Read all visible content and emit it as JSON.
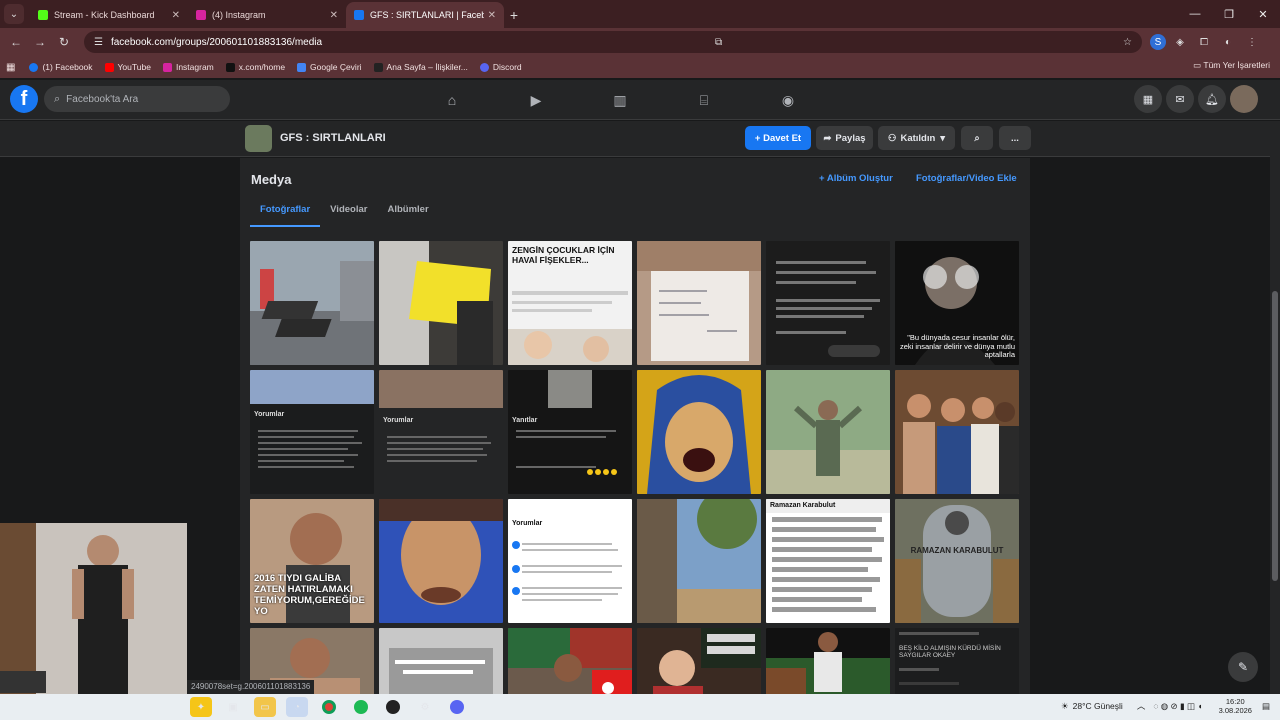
{
  "browser": {
    "tabs": [
      {
        "title": "Stream - Kick Dashboard",
        "color": "#53fc18",
        "active": false
      },
      {
        "title": "(4) Instagram",
        "color": "#d6249f",
        "active": false
      },
      {
        "title": "GFS : SIRTLANLARI | Facebook",
        "color": "#1877f2",
        "active": true
      }
    ],
    "url_host": "facebook.com",
    "url_path": "/groups/200601101883136/media",
    "bookmarks": [
      {
        "label": "(1) Facebook",
        "color": "#1877f2"
      },
      {
        "label": "YouTube",
        "color": "#ff0000"
      },
      {
        "label": "Instagram",
        "color": "#d6249f"
      },
      {
        "label": "x.com/home",
        "color": "#111111"
      },
      {
        "label": "Google Çeviri",
        "color": "#4285f4"
      },
      {
        "label": "Ana Sayfa – İlişkiler...",
        "color": "#222222"
      },
      {
        "label": "Discord",
        "color": "#5865f2"
      }
    ],
    "bookmarks_right": "Tüm Yer İşaretleri"
  },
  "fb": {
    "search_placeholder": "Facebook'ta Ara"
  },
  "group": {
    "name": "GFS : SIRTLANLARI",
    "invite": "+ Davet Et",
    "share": "Paylaş",
    "joined": "Katıldın",
    "more": "..."
  },
  "media": {
    "title": "Medya",
    "create_album": "+ Albüm Oluştur",
    "add_media": "Fotoğraflar/Video Ekle",
    "tabs": [
      "Fotoğraflar",
      "Videolar",
      "Albümler"
    ]
  },
  "photos": [
    {
      "caption": "",
      "bg": "#8d9aa6"
    },
    {
      "caption": "",
      "bg": "#3d3b38"
    },
    {
      "caption": "ZENGİN ÇOCUKLAR İÇİN HAVAİ FİŞEKLER...",
      "bg": "#f2f2f2"
    },
    {
      "caption": "",
      "bg": "#b59a86"
    },
    {
      "caption": "",
      "bg": "#1c1c1c"
    },
    {
      "caption": "\"Bu dünyada cesur insanlar ölür, zeki insanlar delirir ve dünya mutlu aptallarla",
      "bg": "#101010"
    },
    {
      "caption": "Yorumlar",
      "bg": "#1b1c1d"
    },
    {
      "caption": "Yorumlar",
      "bg": "#1f2021"
    },
    {
      "caption": "Yanıtlar",
      "bg": "#151515"
    },
    {
      "caption": "",
      "bg": "#d4a418"
    },
    {
      "caption": "",
      "bg": "#7f9a74"
    },
    {
      "caption": "",
      "bg": "#6d4b32"
    },
    {
      "caption": "2016 TIYDI GALİBA ZATEN HATIRLAMAKI TEMİYORUM,GEREĞİDE YO",
      "bg": "#b89a80"
    },
    {
      "caption": "",
      "bg": "#2f52b8"
    },
    {
      "caption": "Yorumlar",
      "bg": "#ffffff"
    },
    {
      "caption": "",
      "bg": "#7ca0c8"
    },
    {
      "caption": "Ramazan Karabulut",
      "bg": "#ffffff"
    },
    {
      "caption": "RAMAZAN KARABULUT",
      "bg": "#6e7060"
    },
    {
      "caption": "",
      "bg": "#8a7866"
    },
    {
      "caption": "",
      "bg": "#c8c8c8"
    },
    {
      "caption": "",
      "bg": "#6b5a4c"
    },
    {
      "caption": "",
      "bg": "#3a2a22"
    },
    {
      "caption": "",
      "bg": "#2b5a2b"
    },
    {
      "caption": "BEŞ KİLO ALMIŞIN KÜRDÜ MİSİN SAYGILAR OKAEY",
      "bg": "#1c1d1e"
    }
  ],
  "status_url": "2490078set=g.200601101883136",
  "taskbar": {
    "weather": "28°C  Güneşli",
    "time": "16:20",
    "date": "3.08.2026"
  }
}
